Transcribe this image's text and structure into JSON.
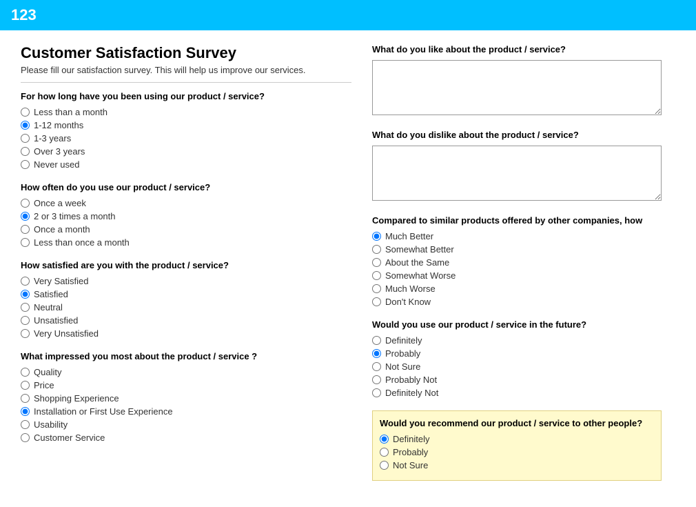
{
  "header": {
    "logo": "123"
  },
  "survey": {
    "title": "Customer Satisfaction Survey",
    "subtitle": "Please fill our satisfaction survey. This will help us improve our services.",
    "questions": {
      "usage_duration": {
        "label": "For how long have you been using our product / service?",
        "options": [
          "Less than a month",
          "1-12 months",
          "1-3 years",
          "Over 3 years",
          "Never used"
        ],
        "selected": "1-12 months"
      },
      "usage_frequency": {
        "label": "How often do you use our product / service?",
        "options": [
          "Once a week",
          "2 or 3 times a month",
          "Once a month",
          "Less than once a month"
        ],
        "selected": "2 or 3 times a month"
      },
      "satisfaction": {
        "label": "How satisfied are you with the product / service?",
        "options": [
          "Very Satisfied",
          "Satisfied",
          "Neutral",
          "Unsatisfied",
          "Very Unsatisfied"
        ],
        "selected": "Satisfied"
      },
      "impressed": {
        "label": "What impressed you most about the product / service ?",
        "options": [
          "Quality",
          "Price",
          "Shopping Experience",
          "Installation or First Use Experience",
          "Usability",
          "Customer Service"
        ],
        "selected": "Installation or First Use Experience"
      }
    }
  },
  "right": {
    "like_label": "What do you like about the product / service?",
    "like_placeholder": "",
    "dislike_label": "What do you dislike about the product / service?",
    "dislike_placeholder": "",
    "comparison": {
      "label": "Compared to similar products offered by other companies, how",
      "options": [
        "Much Better",
        "Somewhat Better",
        "About the Same",
        "Somewhat Worse",
        "Much Worse",
        "Don't Know"
      ],
      "selected": "Much Better"
    },
    "future_use": {
      "label": "Would you use our product / service in the future?",
      "options": [
        "Definitely",
        "Probably",
        "Not Sure",
        "Probably Not",
        "Definitely Not"
      ],
      "selected": "Probably"
    },
    "recommend": {
      "label": "Would you recommend our product / service to other people?",
      "options": [
        "Definitely",
        "Probably",
        "Not Sure"
      ],
      "selected": "Definitely"
    }
  }
}
